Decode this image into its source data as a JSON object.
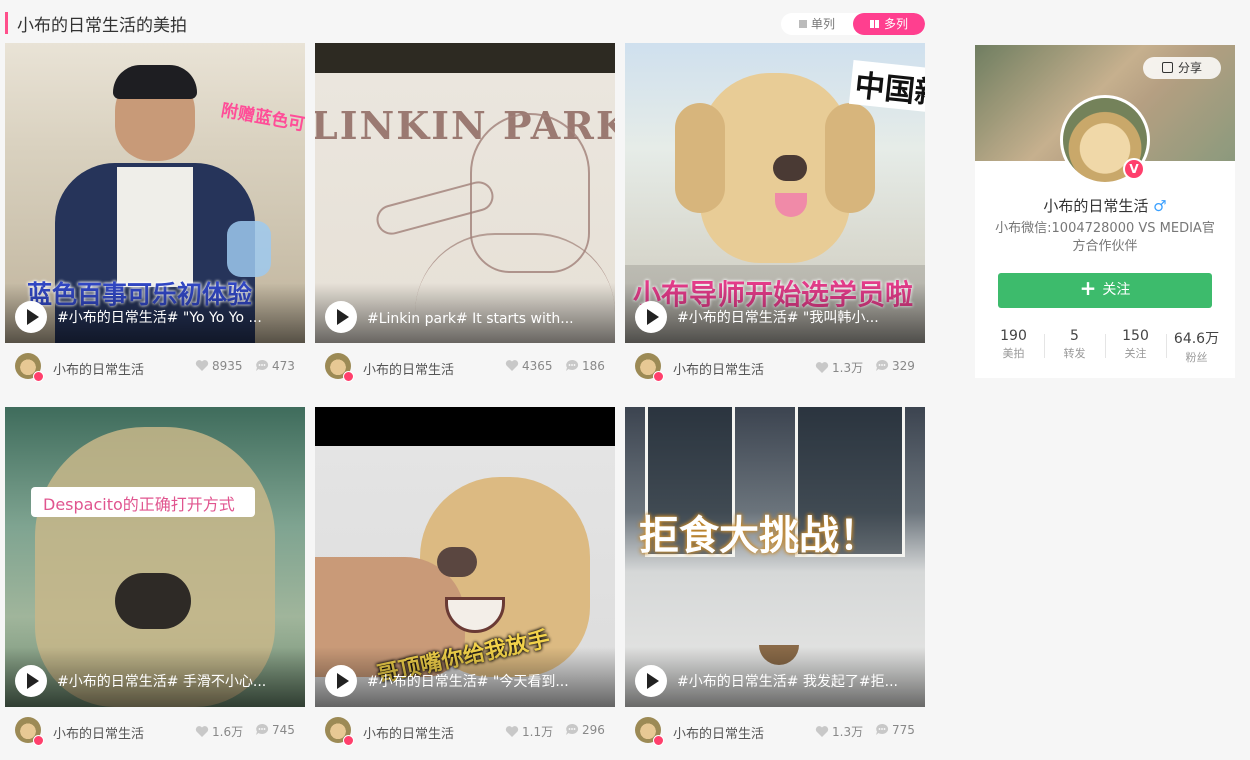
{
  "header": {
    "title": "小布的日常生活的美拍",
    "view_single": "单列",
    "view_multi": "多列"
  },
  "videos": [
    {
      "caption": "#小布的日常生活# \"Yo Yo Yo ...",
      "author": "小布的日常生活",
      "likes": "8935",
      "comments": "473",
      "overlay_main": "蓝色百事可乐初体验",
      "overlay_side": "附赠蓝色可"
    },
    {
      "caption": "#Linkin park# It starts with...",
      "author": "小布的日常生活",
      "likes": "4365",
      "comments": "186",
      "overlay_main": "LINKIN PARK"
    },
    {
      "caption": "#小布的日常生活# \"我叫韩小...",
      "author": "小布的日常生活",
      "likes": "1.3万",
      "comments": "329",
      "overlay_main": "小布导师开始选学员啦",
      "overlay_side": "中国新"
    },
    {
      "caption": "#小布的日常生活# 手滑不小心...",
      "author": "小布的日常生活",
      "likes": "1.6万",
      "comments": "745",
      "overlay_main": "Despacito的正确打开方式"
    },
    {
      "caption": "#小布的日常生活# \"今天看到...",
      "author": "小布的日常生活",
      "likes": "1.1万",
      "comments": "296",
      "overlay_main": "哥顶嘴你给我放手"
    },
    {
      "caption": "#小布的日常生活# 我发起了#拒...",
      "author": "小布的日常生活",
      "likes": "1.3万",
      "comments": "775",
      "overlay_main": "拒食大挑战！"
    }
  ],
  "profile": {
    "share_label": "分享",
    "name": "小布的日常生活",
    "gender_symbol": "♂",
    "description": "小布微信:1004728000 VS MEDIA官方合作伙伴",
    "follow_label": "关注",
    "verified_mark": "V",
    "stats": [
      {
        "value": "190",
        "label": "美拍"
      },
      {
        "value": "5",
        "label": "转发"
      },
      {
        "value": "150",
        "label": "关注"
      },
      {
        "value": "64.6万",
        "label": "粉丝"
      }
    ]
  },
  "colors": {
    "accent_pink": "#ff3f8f",
    "follow_green": "#3dbb6c",
    "verified_red": "#ff3f6c"
  }
}
